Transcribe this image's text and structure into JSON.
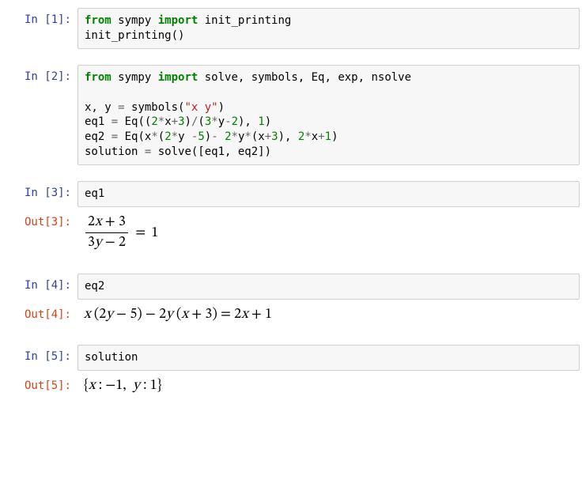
{
  "cells": {
    "c1": {
      "in_prompt": "In [1]:",
      "code_html": "<span class=\"kw\">from</span> sympy <span class=\"kw\">import</span> init_printing\ninit_printing()"
    },
    "c2": {
      "in_prompt": "In [2]:",
      "code_html": "<span class=\"kw\">from</span> sympy <span class=\"kw\">import</span> solve, symbols, Eq, exp, nsolve\n\nx, y <span class=\"op\">=</span> symbols(<span class=\"str\">\"x y\"</span>)\neq1 <span class=\"op\">=</span> Eq((<span class=\"num\">2</span><span class=\"op\">*</span>x<span class=\"op\">+</span><span class=\"num\">3</span>)<span class=\"op\">/</span>(<span class=\"num\">3</span><span class=\"op\">*</span>y<span class=\"op\">-</span><span class=\"num\">2</span>), <span class=\"num\">1</span>)\neq2 <span class=\"op\">=</span> Eq(x<span class=\"op\">*</span>(<span class=\"num\">2</span><span class=\"op\">*</span>y <span class=\"op\">-</span><span class=\"num\">5</span>)<span class=\"op\">-</span> <span class=\"num\">2</span><span class=\"op\">*</span>y<span class=\"op\">*</span>(x<span class=\"op\">+</span><span class=\"num\">3</span>), <span class=\"num\">2</span><span class=\"op\">*</span>x<span class=\"op\">+</span><span class=\"num\">1</span>)\nsolution <span class=\"op\">=</span> solve([eq1, eq2])"
    },
    "c3": {
      "in_prompt": "In [3]:",
      "code_html": "eq1",
      "out_prompt": "Out[3]:",
      "out_math": {
        "type": "eq1",
        "num_top": "2x + 3",
        "den": "3y − 2",
        "rhs": "1"
      }
    },
    "c4": {
      "in_prompt": "In [4]:",
      "code_html": "eq2",
      "out_prompt": "Out[4]:",
      "out_math": {
        "type": "eq2",
        "text": "x (2y − 5) − 2y (x + 3) = 2x + 1"
      }
    },
    "c5": {
      "in_prompt": "In [5]:",
      "code_html": "solution",
      "out_prompt": "Out[5]:",
      "out_math": {
        "type": "sol",
        "text": "{x : −1,  y : 1}"
      }
    }
  }
}
